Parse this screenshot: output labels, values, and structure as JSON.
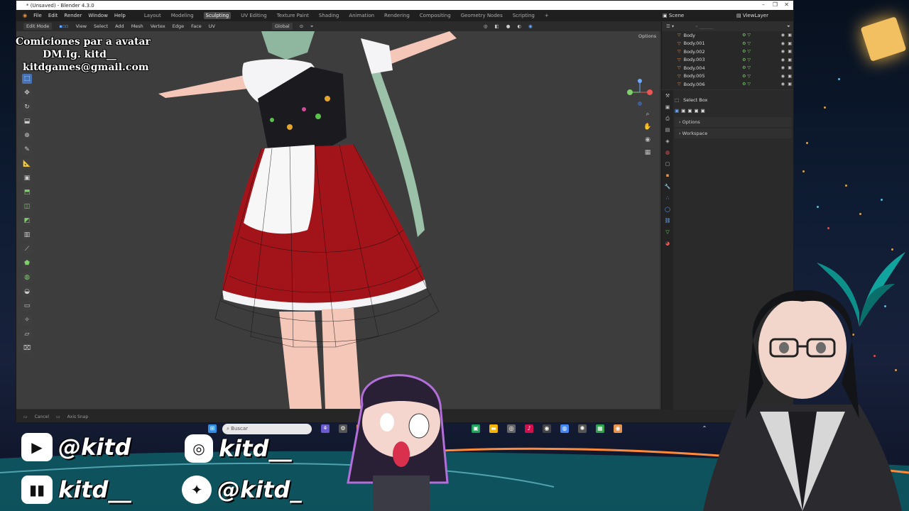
{
  "window": {
    "title": "* (Unsaved) - Blender 4.3.0"
  },
  "menu": [
    "File",
    "Edit",
    "Render",
    "Window",
    "Help"
  ],
  "workspaces": [
    "Layout",
    "Modeling",
    "Sculpting",
    "UV Editing",
    "Texture Paint",
    "Shading",
    "Animation",
    "Rendering",
    "Compositing",
    "Geometry Nodes",
    "Scripting"
  ],
  "active_workspace": "Sculpting",
  "header": {
    "mode": "Edit Mode",
    "view": "View",
    "select": "Select",
    "add": "Add",
    "mesh": "Mesh",
    "vertex": "Vertex",
    "edge": "Edge",
    "face": "Face",
    "uv": "UV",
    "orientation": "Global",
    "options": "Options"
  },
  "scene": {
    "scene_label": "Scene",
    "view_layer": "ViewLayer"
  },
  "outliner": {
    "search_placeholder": "",
    "items": [
      "Body",
      "Body.001",
      "Body.002",
      "Body.003",
      "Body.004",
      "Body.005",
      "Body.006"
    ]
  },
  "properties": {
    "tool_name": "Select Box",
    "panels": [
      "Options",
      "Workspace"
    ]
  },
  "status_bar": {
    "cancel": "Cancel",
    "axis_snap": "Axis Snap"
  },
  "overlay": {
    "line1": "Comiciones par a avatar",
    "line2": "DM.Ig. kitd__",
    "line3": "kitdgames@gmail.com"
  },
  "taskbar": {
    "search_placeholder": "Buscar"
  },
  "socials": [
    {
      "icon": "youtube-icon",
      "handle": "@kitd"
    },
    {
      "icon": "instagram-icon",
      "handle": "kitd__"
    },
    {
      "icon": "twitch-icon",
      "handle": "kitd__"
    },
    {
      "icon": "twitter-icon",
      "handle": "@kitd_"
    }
  ],
  "colors": {
    "blender_bg": "#303030",
    "viewport": "#3d3d3d",
    "accent_blue": "#4772b3",
    "skirt_red": "#a3141a"
  }
}
